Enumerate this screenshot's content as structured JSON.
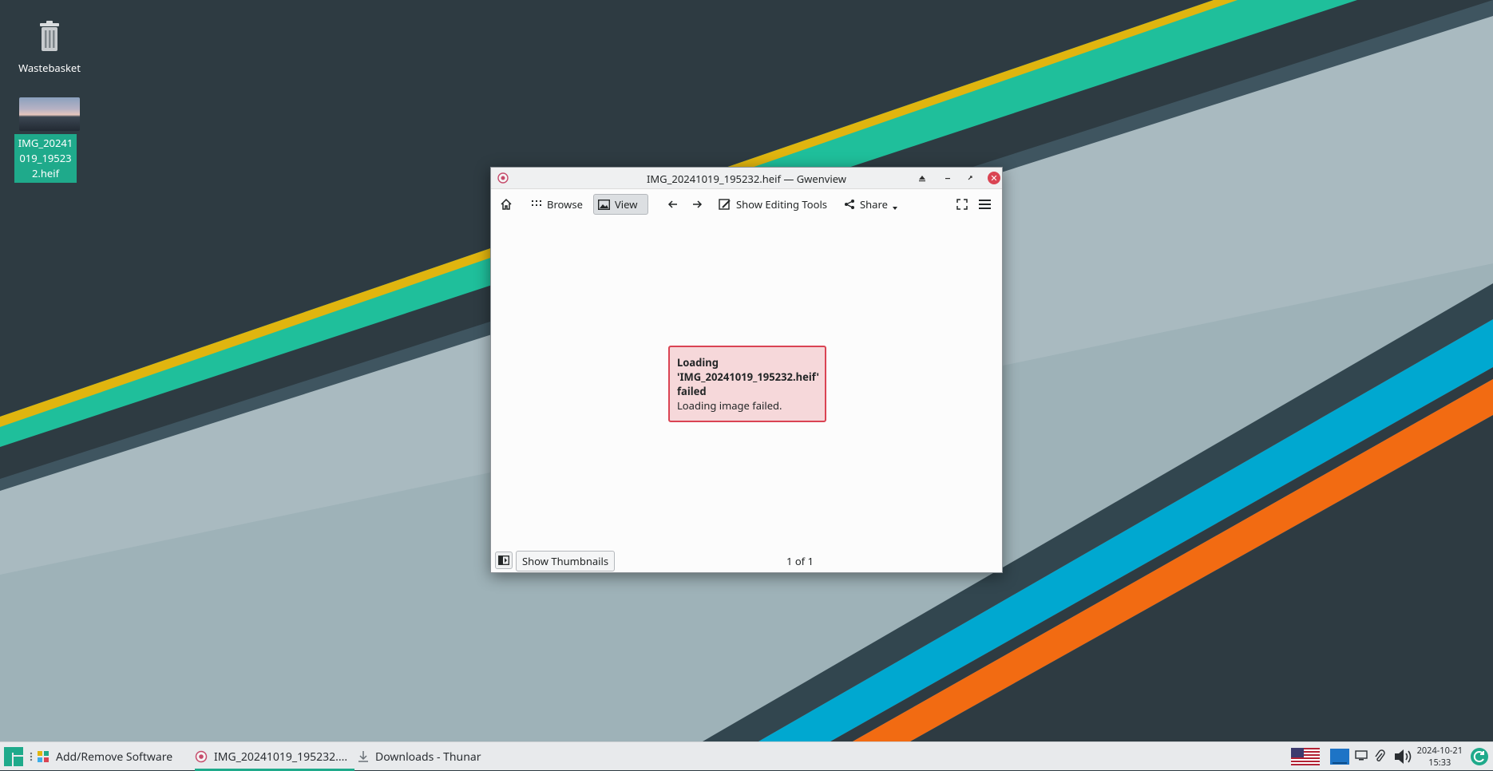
{
  "desktop": {
    "wastebasket_label": "Wastebasket",
    "image_file_label": "IMG_20241019_195232.heif"
  },
  "window": {
    "title": "IMG_20241019_195232.heif  — Gwenview",
    "toolbar": {
      "browse": "Browse",
      "view": "View",
      "editing_tools": "Show Editing Tools",
      "share": "Share"
    },
    "error": {
      "line1": "Loading",
      "filename": "'IMG_20241019_195232.heif'",
      "line3": "failed",
      "message": "Loading image failed."
    },
    "statusbar": {
      "show_thumbnails": "Show Thumbnails",
      "page_count": "1 of 1"
    }
  },
  "taskbar": {
    "tasks": [
      {
        "label": "Add/Remove Software"
      },
      {
        "label": "IMG_20241019_195232...."
      },
      {
        "label": "Downloads - Thunar"
      }
    ],
    "date": "2024-10-21",
    "time": "15:33"
  },
  "colors": {
    "accent": "#1faa8b",
    "error_border": "#da4453",
    "error_bg": "#f6d8da",
    "wallpaper_dark": "#2e3b42"
  }
}
